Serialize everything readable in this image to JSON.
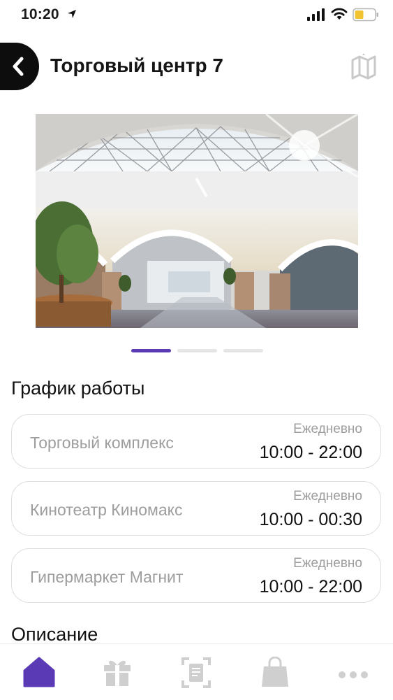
{
  "status_bar": {
    "time": "10:20"
  },
  "header": {
    "title": "Торговый центр 7"
  },
  "gallery": {
    "total_slides": 3,
    "active_slide": 1
  },
  "schedule": {
    "title": "График работы",
    "items": [
      {
        "name": "Торговый комплекс",
        "period": "Ежедневно",
        "hours": "10:00 - 22:00"
      },
      {
        "name": "Кинотеатр Киномакс",
        "period": "Ежедневно",
        "hours": "10:00 - 00:30"
      },
      {
        "name": "Гипермаркет Магнит",
        "period": "Ежедневно",
        "hours": "10:00 - 22:00"
      }
    ]
  },
  "description": {
    "title": "Описание"
  },
  "tab_bar": {
    "items": [
      {
        "icon": "home-icon",
        "active": true
      },
      {
        "icon": "gift-icon",
        "active": false
      },
      {
        "icon": "scan-document-icon",
        "active": false
      },
      {
        "icon": "shopping-bag-icon",
        "active": false
      },
      {
        "icon": "more-dots-icon",
        "active": false
      }
    ]
  },
  "colors": {
    "accent": "#5a3bb5",
    "inactive_icon": "#cfcfcf",
    "secondary_text": "#9d9d9d",
    "back_button_bg": "#0d0d0d"
  }
}
